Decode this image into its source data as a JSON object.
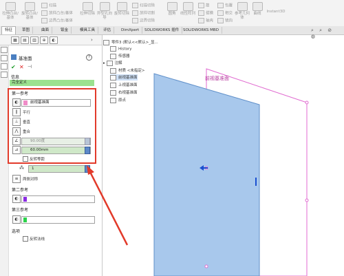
{
  "ribbon": {
    "groups": [
      {
        "label": "拉伸凸台/基体"
      },
      {
        "label": "旋转凸台/基体"
      },
      {
        "label": "拉伸切除"
      },
      {
        "label": "异型孔向导"
      },
      {
        "label": "旋转切除"
      },
      {
        "label": "圆角"
      },
      {
        "label": "线性阵列"
      },
      {
        "label": "筋"
      },
      {
        "label": "参考几何体"
      },
      {
        "label": "曲线"
      },
      {
        "label": "Instant3D"
      }
    ],
    "small_items": [
      {
        "label": "扫描"
      },
      {
        "label": "放样凸台/基体"
      },
      {
        "label": "边界凸台/基体"
      },
      {
        "label": "扫描切除"
      },
      {
        "label": "放样切割"
      },
      {
        "label": "边界切除"
      },
      {
        "label": "包覆"
      },
      {
        "label": "拔模"
      },
      {
        "label": "相交"
      },
      {
        "label": "抽壳"
      },
      {
        "label": "镜向"
      }
    ]
  },
  "tabs": [
    "特征",
    "草图",
    "曲面",
    "钣金",
    "模具工具",
    "评估",
    "DimXpert",
    "SOLIDWORKS 插件",
    "SOLIDWORKS MBD"
  ],
  "panel": {
    "title": "基准面",
    "help": "?",
    "message_header": "信息",
    "message": "完全定义",
    "first_ref": {
      "header": "第一参考",
      "selection": "前视基准面",
      "options": [
        "平行",
        "垂直",
        "重合"
      ],
      "angle": "90.00度",
      "distance": "60.00mm",
      "flip_offset": "反转等距",
      "count": "1",
      "mid_plane": "两侧对称"
    },
    "second_ref": {
      "header": "第二参考"
    },
    "third_ref": {
      "header": "第三参考"
    },
    "options": {
      "header": "选项",
      "flip_normal": "反转法线"
    }
  },
  "tree": {
    "root": "零件3  (默认<<默认>_显...",
    "items": [
      "History",
      "传感器",
      "注解",
      "材质 <未指定>",
      "前视基准面",
      "上视基准面",
      "右视基准面",
      "原点"
    ]
  },
  "viewport": {
    "plane_label": "前视基准面"
  },
  "colors": {
    "accent_red": "#e23a2a",
    "plane_blue": "#a8c8ec",
    "preview_magenta": "#e06ad0",
    "status_green": "#9be28f"
  }
}
